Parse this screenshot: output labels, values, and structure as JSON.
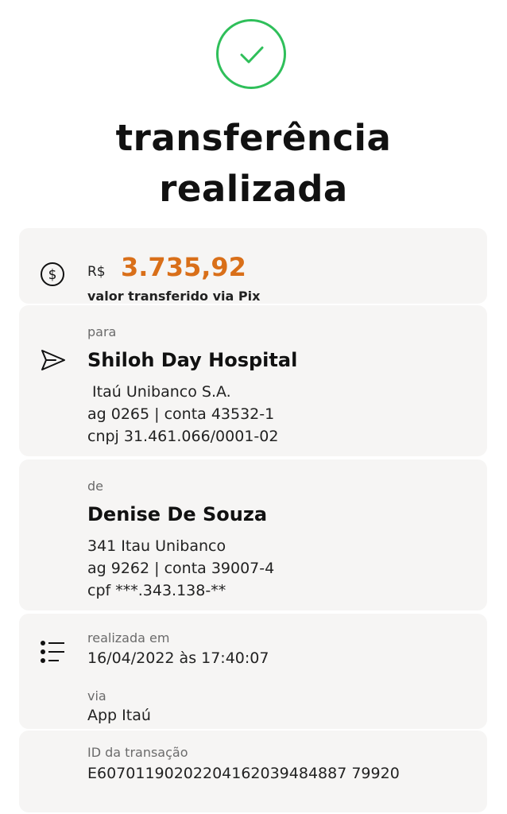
{
  "header": {
    "status_icon": "check-circle-icon",
    "title_line1": "transferência",
    "title_line2": "realizada",
    "accent_color": "#2fbf5a"
  },
  "amount": {
    "icon": "dollar-circle-icon",
    "currency": "R$",
    "value": "3.735,92",
    "label": "valor transferido via Pix",
    "value_color": "#d96f19"
  },
  "recipient": {
    "icon": "send-icon",
    "label": "para",
    "name": "Shiloh Day Hospital",
    "bank": " Itaú Unibanco S.A.",
    "account": "ag 0265 | conta 43532-1",
    "document": "cnpj 31.461.066/0001-02"
  },
  "sender": {
    "label": "de",
    "name": "Denise De Souza",
    "bank": "341 Itau Unibanco",
    "account": "ag 9262 | conta 39007-4",
    "document": "cpf ***.343.138-**"
  },
  "details": {
    "icon": "list-icon",
    "date_label": "realizada em",
    "date_value": "16/04/2022 às 17:40:07",
    "channel_label": "via",
    "channel_value": "App Itaú",
    "id_label": "ID da transação",
    "id_value": "E60701190202204162039484887 79920"
  }
}
